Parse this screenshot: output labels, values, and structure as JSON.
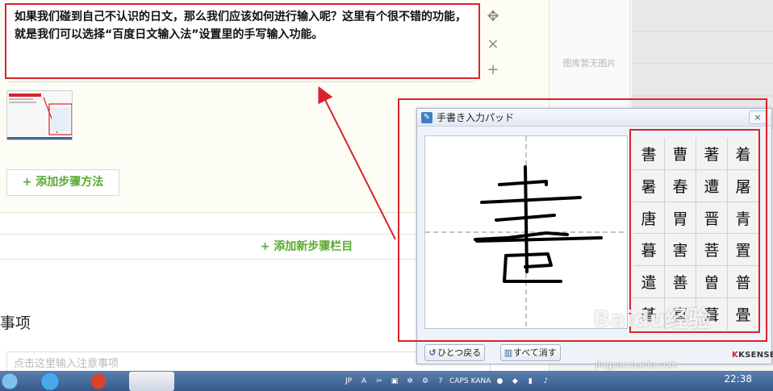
{
  "step": {
    "text": "如果我们碰到自己不认识的日文，那么我们应该如何进行输入呢？这里有个很不错的功能，就是我们可以选择“百度日文输入法”设置里的手写输入功能。",
    "add_step_label": "+ 添加步骤方法",
    "add_section_label": "+ 添加新步骤栏目"
  },
  "notes": {
    "title": "事项",
    "placeholder": "点击这里输入注意事项"
  },
  "gallery": {
    "empty_text": "图库暂无图片"
  },
  "pad": {
    "title": "手書き入力パッド",
    "close_label": "×",
    "candidates": [
      "書",
      "曹",
      "著",
      "着",
      "暑",
      "春",
      "遭",
      "屠",
      "唐",
      "胃",
      "晋",
      "青",
      "暮",
      "害",
      "菩",
      "置",
      "遣",
      "善",
      "曽",
      "普",
      "碁",
      "喜",
      "葺",
      "畳"
    ],
    "undo_label": "ひとつ戻る",
    "clear_label": "すべて消す",
    "brand_prefix": "K",
    "brand_name": "KSENSE"
  },
  "taskbar": {
    "tray_ime": "JP",
    "tray_caps": "CAPS",
    "tray_kana": "KANA",
    "clock": "22:38"
  },
  "watermark": {
    "text": "Baidu经验",
    "url": "jingyan.baidu.com"
  },
  "colors": {
    "annotation": "#d9232b",
    "accent_green": "#5aa832",
    "taskbar": "#3f6496"
  }
}
